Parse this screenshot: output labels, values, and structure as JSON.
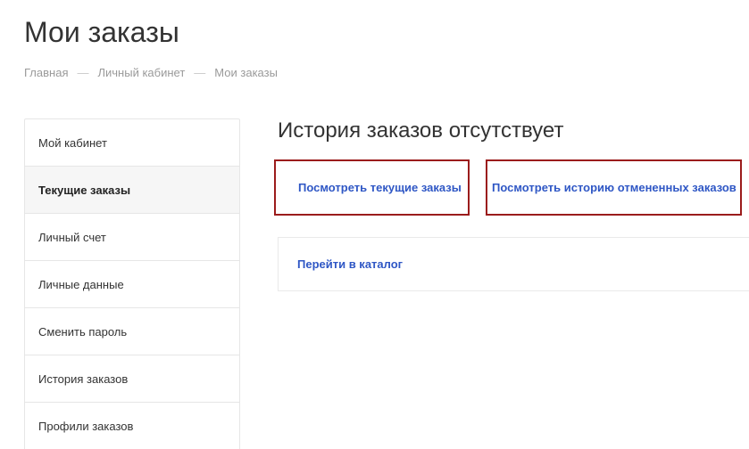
{
  "header": {
    "title": "Мои заказы"
  },
  "breadcrumb": {
    "items": [
      "Главная",
      "Личный кабинет",
      "Мои заказы"
    ],
    "separator": "—"
  },
  "sidebar": {
    "items": [
      {
        "label": "Мой кабинет",
        "active": false
      },
      {
        "label": "Текущие заказы",
        "active": true
      },
      {
        "label": "Личный счет",
        "active": false
      },
      {
        "label": "Личные данные",
        "active": false
      },
      {
        "label": "Сменить пароль",
        "active": false
      },
      {
        "label": "История заказов",
        "active": false
      },
      {
        "label": "Профили заказов",
        "active": false
      }
    ]
  },
  "main": {
    "title": "История заказов отсутствует",
    "current_orders_link": "Посмотреть текущие заказы",
    "cancelled_orders_link": "Посмотреть историю отмененных заказов",
    "catalog_link": "Перейти в каталог"
  },
  "colors": {
    "link": "#2f57c5",
    "highlight_border": "#9b1c1c",
    "active_item_bg": "#f6f6f6"
  }
}
